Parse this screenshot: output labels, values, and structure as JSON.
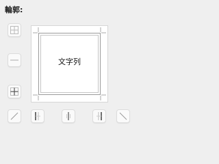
{
  "section": {
    "title": "輪郭:"
  },
  "preview": {
    "text": "文字列"
  },
  "colors": {
    "border_line": "#9a9a9a",
    "active_line": "#333333",
    "button_bg": "#fafafa"
  },
  "buttons": [
    {
      "name": "border-all-button",
      "icon": "grid-all-icon"
    },
    {
      "name": "border-inner-horizontal-button",
      "icon": "horizontal-line-icon"
    },
    {
      "name": "border-inner-all-button",
      "icon": "grid-inner-icon"
    },
    {
      "name": "diagonal-up-button",
      "icon": "diagonal-up-icon"
    },
    {
      "name": "border-left-button",
      "icon": "border-left-icon"
    },
    {
      "name": "border-inner-vertical-button",
      "icon": "vertical-line-icon"
    },
    {
      "name": "border-right-button",
      "icon": "border-right-icon"
    },
    {
      "name": "diagonal-down-button",
      "icon": "diagonal-down-icon"
    }
  ]
}
